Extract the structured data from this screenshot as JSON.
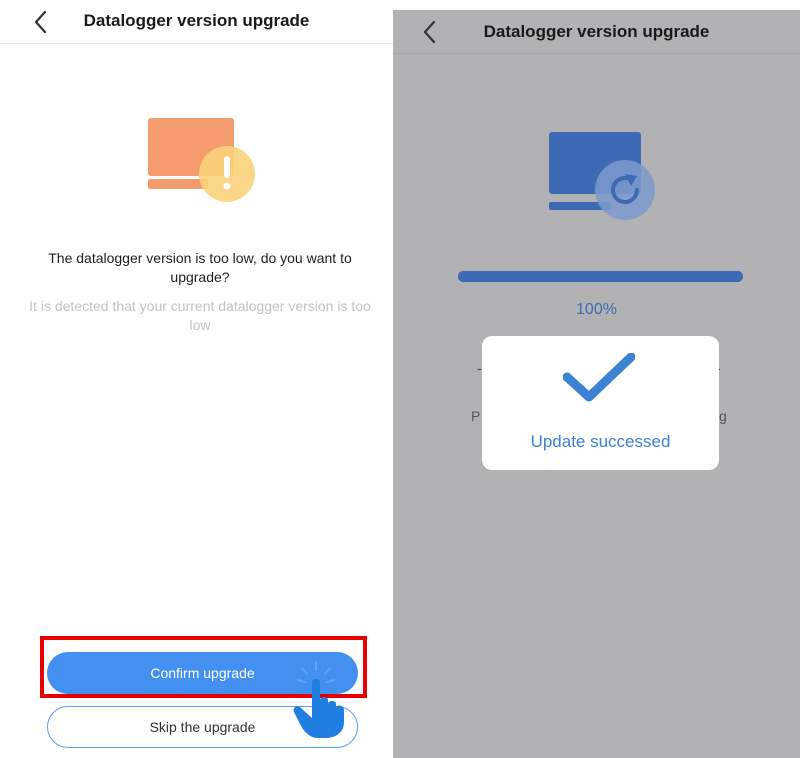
{
  "left_screen": {
    "header": {
      "title": "Datalogger version upgrade"
    },
    "illustration": {
      "icon": "monitor-warning-icon",
      "colors": {
        "monitor": "#f59c6e",
        "badge": "#fbd27a"
      }
    },
    "message": {
      "main": "The datalogger version is too low, do you want to upgrade?",
      "sub": "It is detected that your current datalogger version is too low"
    },
    "buttons": {
      "confirm": "Confirm upgrade",
      "skip": "Skip the upgrade"
    },
    "highlight_color": "#e60000",
    "pointer": "hand-pointer-icon"
  },
  "right_screen": {
    "header": {
      "title": "Datalogger version upgrade"
    },
    "illustration": {
      "icon": "monitor-refresh-icon",
      "color": "#3d6ab4"
    },
    "progress": {
      "percent_text": "100%",
      "value": 1.0
    },
    "background_text": {
      "left1": "-",
      "right1": "-",
      "left2": "P",
      "right2": "g"
    },
    "dialog": {
      "icon": "checkmark-icon",
      "message": "Update successed",
      "accent": "#3b82d2"
    }
  }
}
